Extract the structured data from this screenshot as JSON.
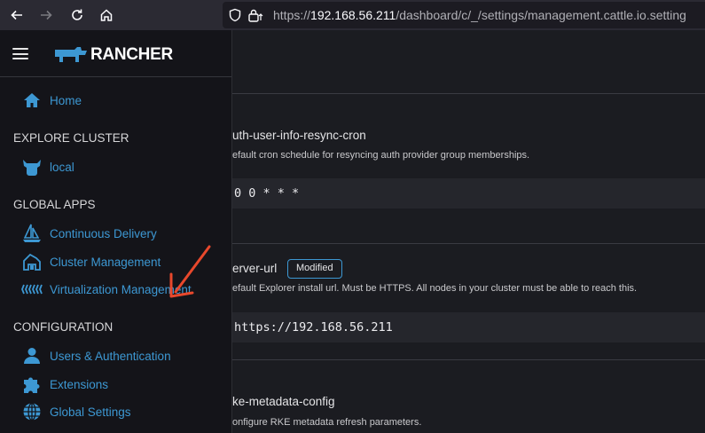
{
  "browser": {
    "url_scheme": "https://",
    "url_host": "192.168.56.211",
    "url_path": "/dashboard/c/_/settings/management.cattle.io.setting"
  },
  "brand": {
    "name": "RANCHER"
  },
  "sidebar": {
    "home_label": "Home",
    "explore_heading": "EXPLORE CLUSTER",
    "cluster_label": "local",
    "global_apps_heading": "GLOBAL APPS",
    "global_apps": [
      {
        "label": "Continuous Delivery",
        "icon": "sailboat-icon"
      },
      {
        "label": "Cluster Management",
        "icon": "cluster-farm-icon"
      },
      {
        "label": "Virtualization Management",
        "icon": "harvester-icon"
      }
    ],
    "configuration_heading": "CONFIGURATION",
    "configuration": [
      {
        "label": "Users & Authentication",
        "icon": "user-icon"
      },
      {
        "label": "Extensions",
        "icon": "puzzle-icon"
      },
      {
        "label": "Global Settings",
        "icon": "globe-icon"
      }
    ]
  },
  "settings": [
    {
      "name": "uth-user-info-resync-cron",
      "description": "efault cron schedule for resyncing auth provider group memberships.",
      "value": "0 0 * * *"
    },
    {
      "name": "erver-url",
      "badge": "Modified",
      "description": "efault Explorer install url. Must be HTTPS. All nodes in your cluster must be able to reach this.",
      "value": "https://192.168.56.211"
    },
    {
      "name": "ke-metadata-config",
      "description": "onfigure RKE metadata refresh parameters."
    }
  ],
  "colors": {
    "accent": "#3d98d3",
    "annotation_arrow": "#e8482c",
    "sidebar_bg": "#141419",
    "main_bg": "#1b1c21"
  }
}
